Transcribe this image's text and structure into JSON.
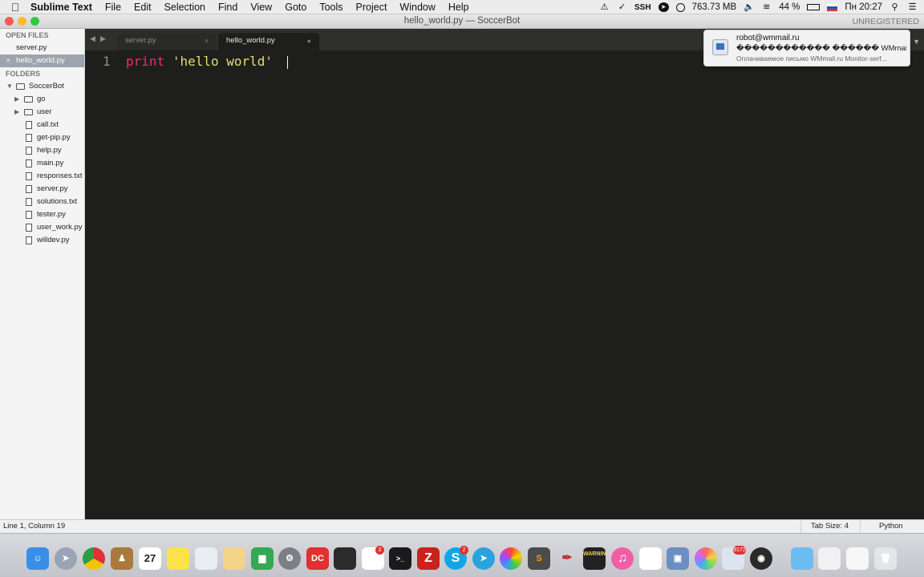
{
  "menubar": {
    "app_name": "Sublime Text",
    "menus": [
      "File",
      "Edit",
      "Selection",
      "Find",
      "View",
      "Goto",
      "Tools",
      "Project",
      "Window",
      "Help"
    ],
    "memory": "763.73 MB",
    "ssh": "SSH",
    "battery": "44 %",
    "clock": "Пн 20:27"
  },
  "window": {
    "title": "hello_world.py — SoccerBot",
    "unregistered": "UNREGISTERED"
  },
  "sidebar": {
    "open_files_header": "OPEN FILES",
    "open_files": [
      "server.py",
      "hello_world.py"
    ],
    "folders_header": "FOLDERS",
    "project": "SoccerBot",
    "subfolders": [
      "go",
      "user"
    ],
    "files": [
      "call.txt",
      "get-pip.py",
      "help.py",
      "main.py",
      "responses.txt",
      "server.py",
      "solutions.txt",
      "tester.py",
      "user_work.py",
      "willdev.py"
    ]
  },
  "tabs": [
    {
      "label": "server.py",
      "close": "×"
    },
    {
      "label": "hello_world.py",
      "close": "●"
    }
  ],
  "editor": {
    "line_number": "1",
    "keyword": "print",
    "string": "'hello world'"
  },
  "notification": {
    "sender": "robot@wmmail.ru",
    "subject": "������������ ������ WMmail....",
    "body": "Оплачиваемое письмо WMmail.ru Monitor-serf..."
  },
  "statusbar": {
    "position": "Line 1, Column 19",
    "tab_size": "Tab Size: 4",
    "syntax": "Python"
  },
  "dock": {
    "calendar_day": "27",
    "badge_1": "3",
    "badge_2": "2",
    "badge_3": "9172",
    "console_text": "WARNIN"
  },
  "colors": {
    "editor_bg": "#1e1f1c",
    "keyword": "#f92672",
    "string": "#e6db74",
    "sidebar_selected": "#9ea4ad"
  }
}
